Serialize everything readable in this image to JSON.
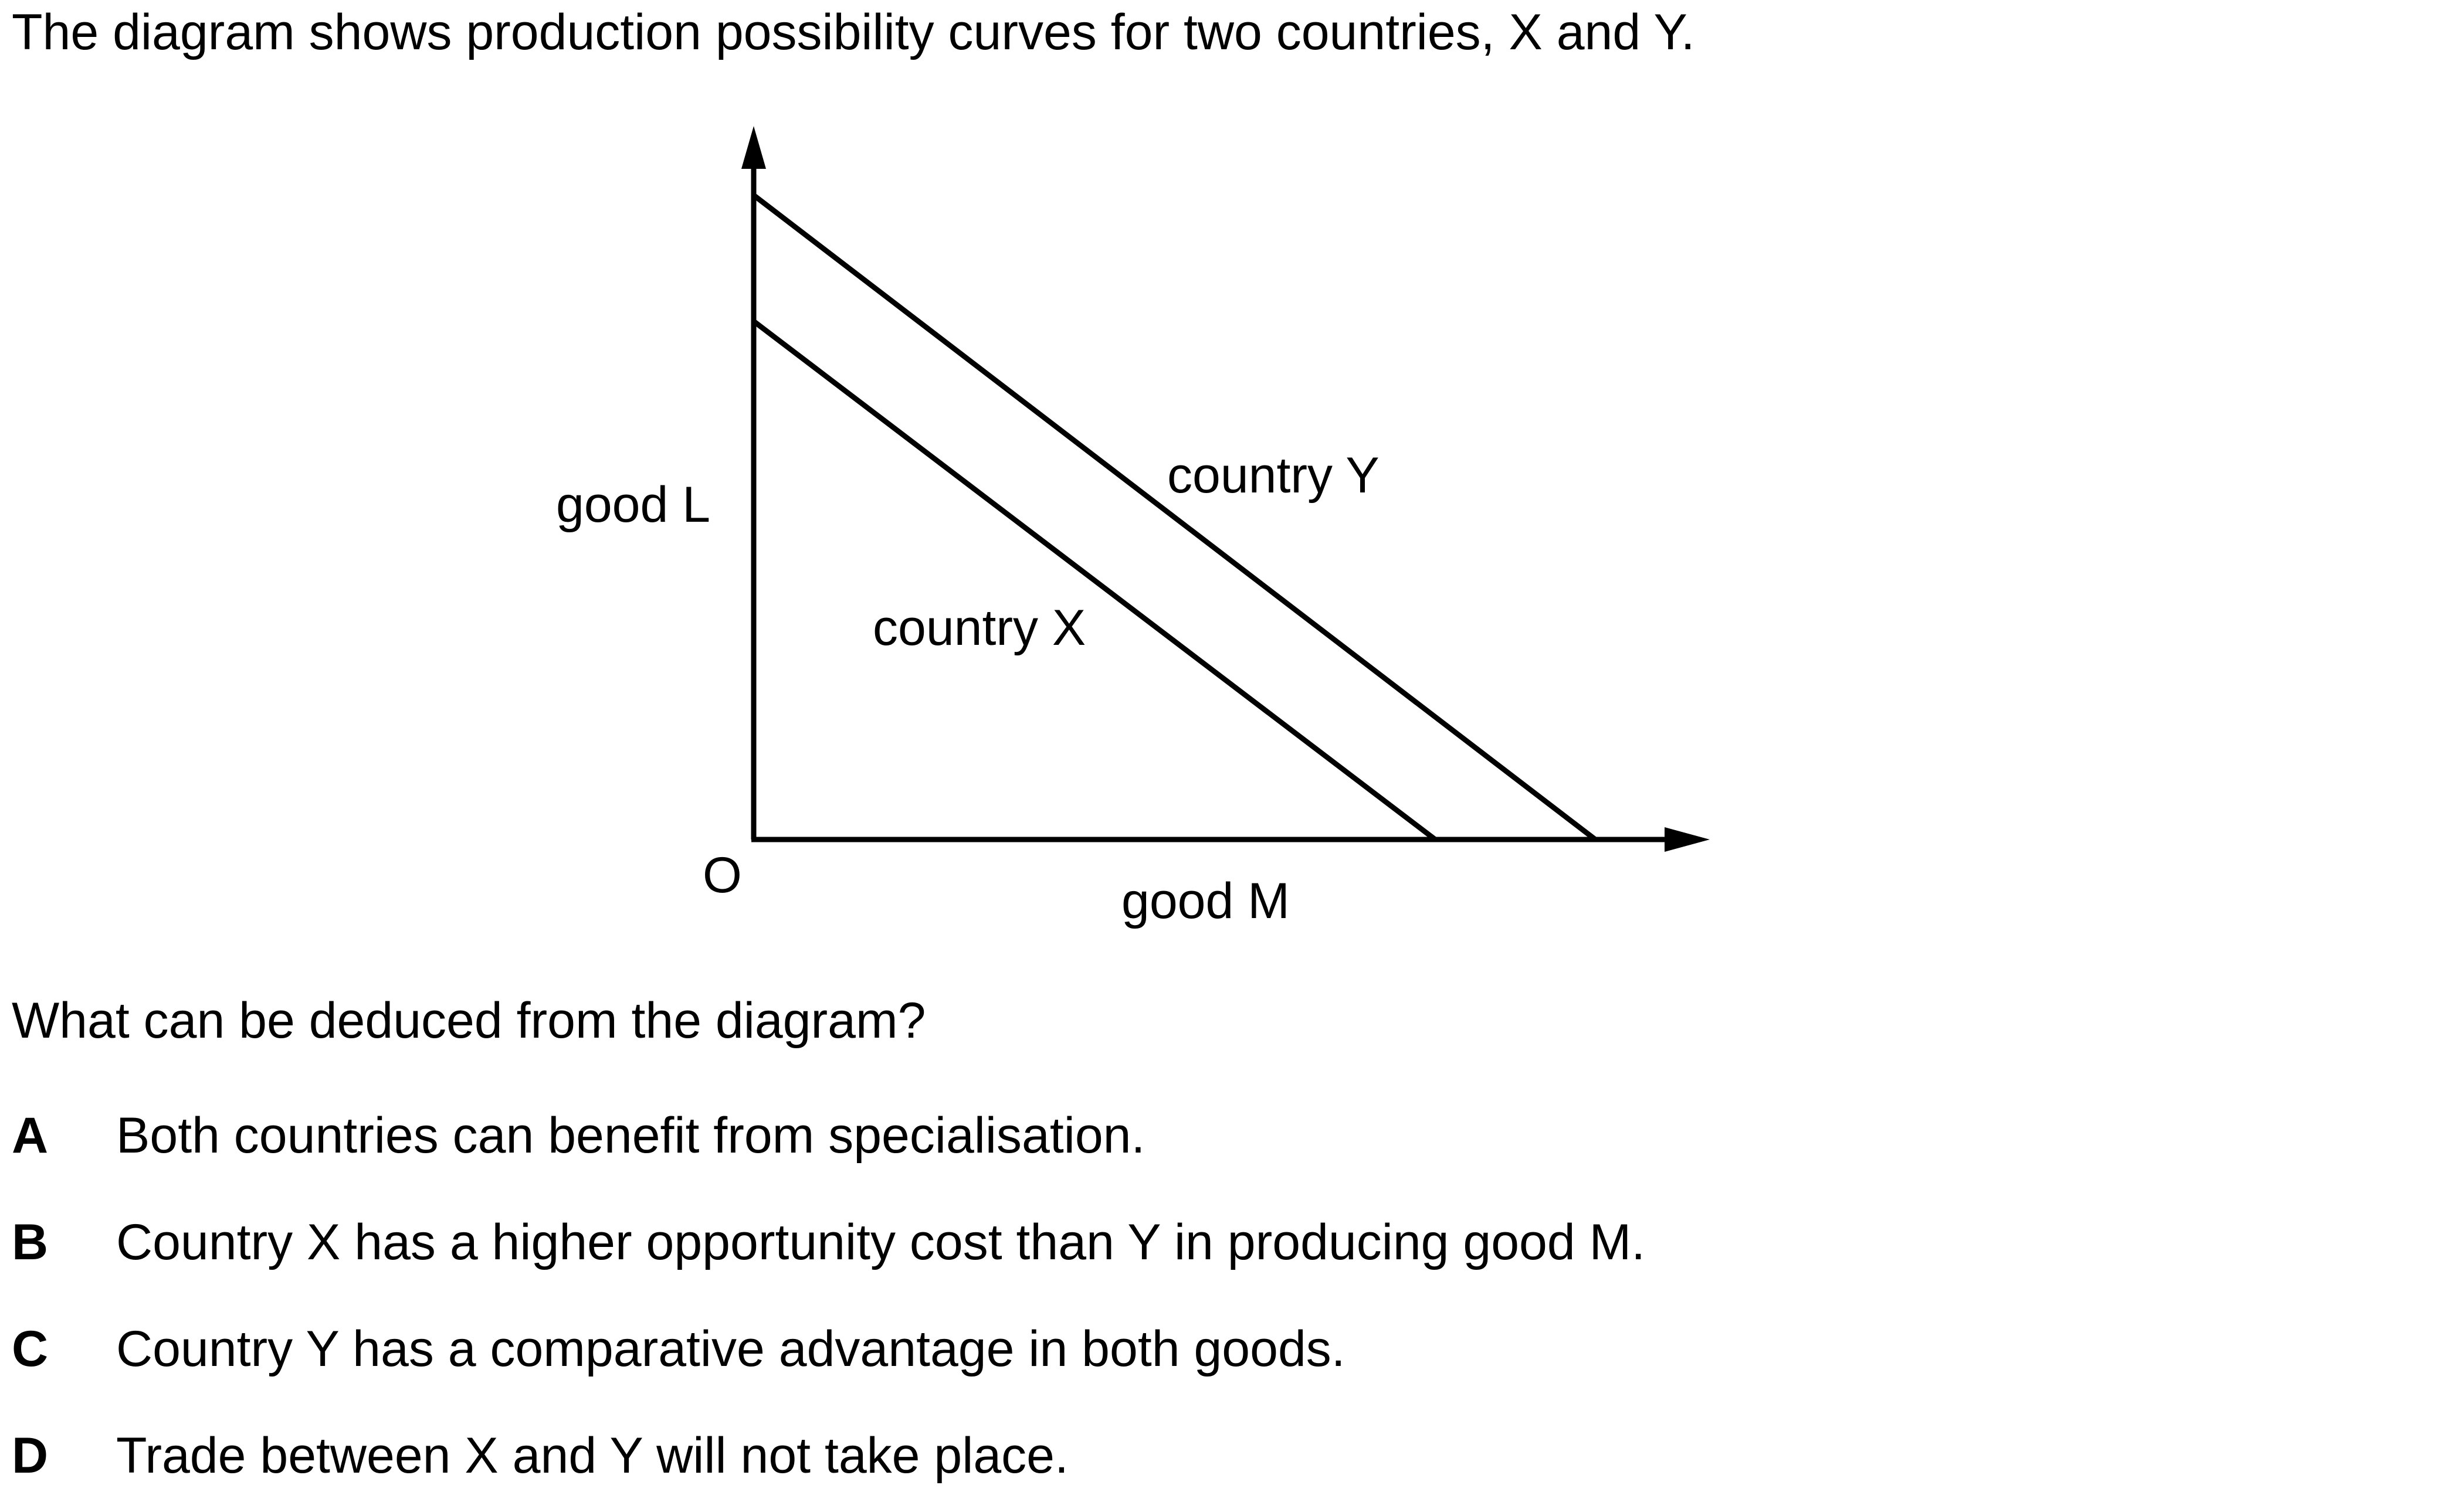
{
  "intro": "The diagram shows production possibility curves for two countries, X and Y.",
  "diagram": {
    "y_axis_label": "good L",
    "x_axis_label": "good M",
    "origin_label": "O",
    "curve_y_label": "country Y",
    "curve_x_label": "country X"
  },
  "question": "What can be deduced from the diagram?",
  "options": [
    {
      "letter": "A",
      "text": "Both countries can benefit from specialisation."
    },
    {
      "letter": "B",
      "text": "Country X has a higher opportunity cost than Y in producing good M."
    },
    {
      "letter": "C",
      "text": "Country Y has a comparative advantage in both goods."
    },
    {
      "letter": "D",
      "text": "Trade between X and Y will not take place."
    }
  ]
}
